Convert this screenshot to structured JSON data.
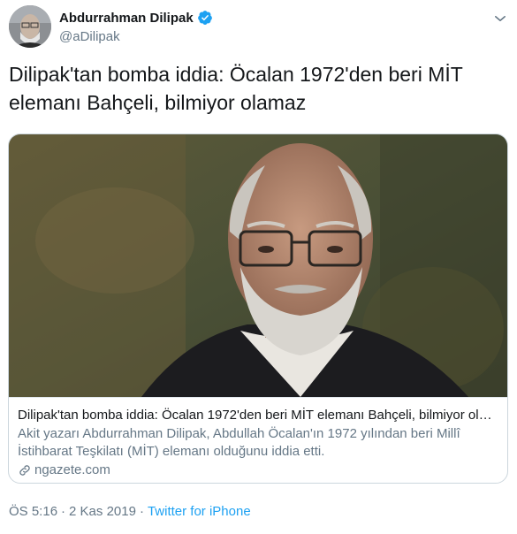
{
  "author": {
    "name": "Abdurrahman Dilipak",
    "handle": "@aDilipak",
    "verified": true
  },
  "tweet": {
    "text": "Dilipak'tan bomba iddia: Öcalan 1972'den beri MİT elemanı Bahçeli, bilmiyor olamaz"
  },
  "card": {
    "title": "Dilipak'tan bomba iddia: Öcalan 1972'den beri MİT elemanı Bahçeli, bilmiyor olamaz",
    "description": "Akit yazarı Abdurrahman Dilipak, Abdullah Öcalan'ın 1972 yılından beri Millî İstihbarat Teşkilatı (MİT) elemanı olduğunu iddia etti.",
    "domain": "ngazete.com"
  },
  "meta": {
    "time": "ÖS 5:16",
    "date": "2 Kas 2019",
    "separator": "·",
    "source": "Twitter for iPhone"
  },
  "icons": {
    "verified": "verified-badge-icon",
    "caret": "chevron-down-icon",
    "link": "link-icon"
  },
  "colors": {
    "accent": "#1da1f2",
    "secondary_text": "#657786",
    "border": "#ccd6dd"
  }
}
